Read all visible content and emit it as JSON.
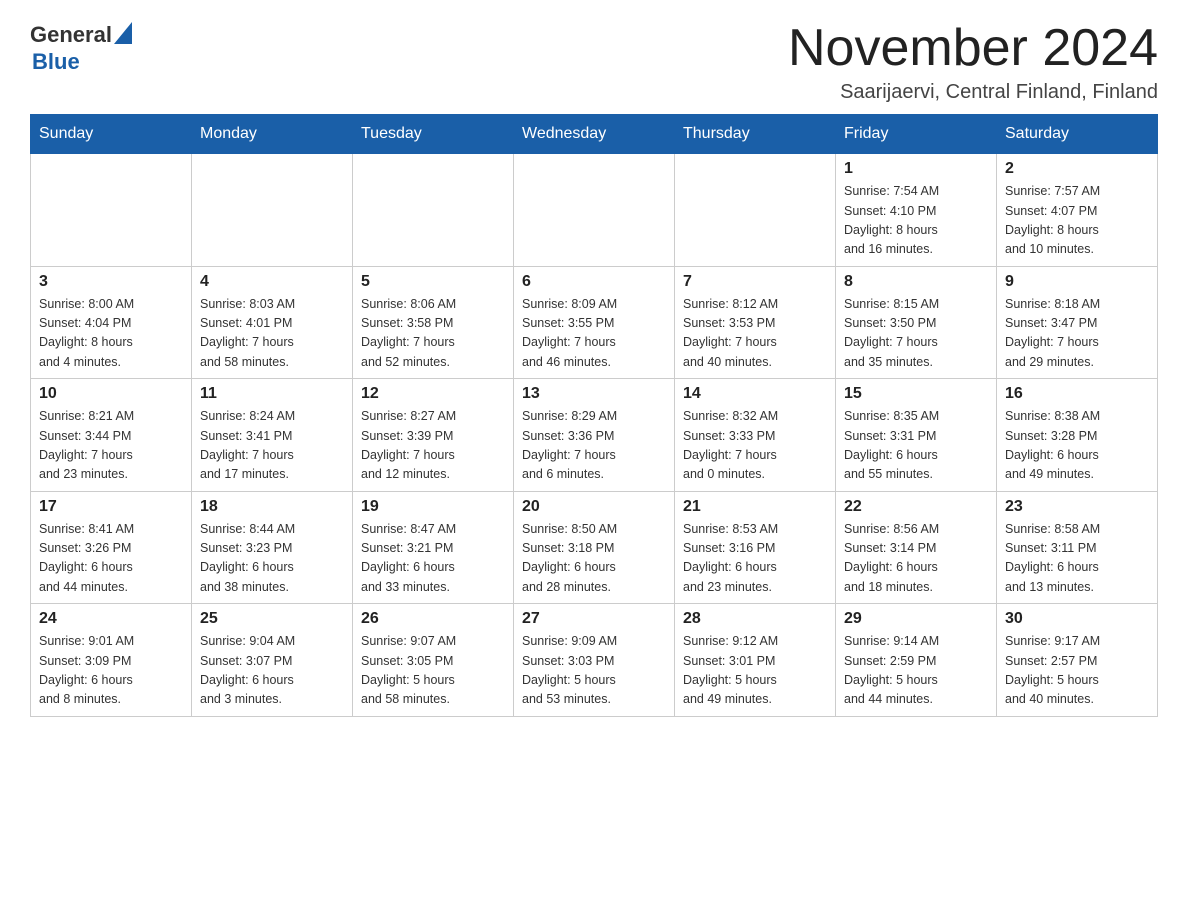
{
  "header": {
    "logo_general": "General",
    "logo_blue": "Blue",
    "month_title": "November 2024",
    "location": "Saarijaervi, Central Finland, Finland"
  },
  "weekdays": [
    "Sunday",
    "Monday",
    "Tuesday",
    "Wednesday",
    "Thursday",
    "Friday",
    "Saturday"
  ],
  "weeks": [
    [
      {
        "day": "",
        "info": ""
      },
      {
        "day": "",
        "info": ""
      },
      {
        "day": "",
        "info": ""
      },
      {
        "day": "",
        "info": ""
      },
      {
        "day": "",
        "info": ""
      },
      {
        "day": "1",
        "info": "Sunrise: 7:54 AM\nSunset: 4:10 PM\nDaylight: 8 hours\nand 16 minutes."
      },
      {
        "day": "2",
        "info": "Sunrise: 7:57 AM\nSunset: 4:07 PM\nDaylight: 8 hours\nand 10 minutes."
      }
    ],
    [
      {
        "day": "3",
        "info": "Sunrise: 8:00 AM\nSunset: 4:04 PM\nDaylight: 8 hours\nand 4 minutes."
      },
      {
        "day": "4",
        "info": "Sunrise: 8:03 AM\nSunset: 4:01 PM\nDaylight: 7 hours\nand 58 minutes."
      },
      {
        "day": "5",
        "info": "Sunrise: 8:06 AM\nSunset: 3:58 PM\nDaylight: 7 hours\nand 52 minutes."
      },
      {
        "day": "6",
        "info": "Sunrise: 8:09 AM\nSunset: 3:55 PM\nDaylight: 7 hours\nand 46 minutes."
      },
      {
        "day": "7",
        "info": "Sunrise: 8:12 AM\nSunset: 3:53 PM\nDaylight: 7 hours\nand 40 minutes."
      },
      {
        "day": "8",
        "info": "Sunrise: 8:15 AM\nSunset: 3:50 PM\nDaylight: 7 hours\nand 35 minutes."
      },
      {
        "day": "9",
        "info": "Sunrise: 8:18 AM\nSunset: 3:47 PM\nDaylight: 7 hours\nand 29 minutes."
      }
    ],
    [
      {
        "day": "10",
        "info": "Sunrise: 8:21 AM\nSunset: 3:44 PM\nDaylight: 7 hours\nand 23 minutes."
      },
      {
        "day": "11",
        "info": "Sunrise: 8:24 AM\nSunset: 3:41 PM\nDaylight: 7 hours\nand 17 minutes."
      },
      {
        "day": "12",
        "info": "Sunrise: 8:27 AM\nSunset: 3:39 PM\nDaylight: 7 hours\nand 12 minutes."
      },
      {
        "day": "13",
        "info": "Sunrise: 8:29 AM\nSunset: 3:36 PM\nDaylight: 7 hours\nand 6 minutes."
      },
      {
        "day": "14",
        "info": "Sunrise: 8:32 AM\nSunset: 3:33 PM\nDaylight: 7 hours\nand 0 minutes."
      },
      {
        "day": "15",
        "info": "Sunrise: 8:35 AM\nSunset: 3:31 PM\nDaylight: 6 hours\nand 55 minutes."
      },
      {
        "day": "16",
        "info": "Sunrise: 8:38 AM\nSunset: 3:28 PM\nDaylight: 6 hours\nand 49 minutes."
      }
    ],
    [
      {
        "day": "17",
        "info": "Sunrise: 8:41 AM\nSunset: 3:26 PM\nDaylight: 6 hours\nand 44 minutes."
      },
      {
        "day": "18",
        "info": "Sunrise: 8:44 AM\nSunset: 3:23 PM\nDaylight: 6 hours\nand 38 minutes."
      },
      {
        "day": "19",
        "info": "Sunrise: 8:47 AM\nSunset: 3:21 PM\nDaylight: 6 hours\nand 33 minutes."
      },
      {
        "day": "20",
        "info": "Sunrise: 8:50 AM\nSunset: 3:18 PM\nDaylight: 6 hours\nand 28 minutes."
      },
      {
        "day": "21",
        "info": "Sunrise: 8:53 AM\nSunset: 3:16 PM\nDaylight: 6 hours\nand 23 minutes."
      },
      {
        "day": "22",
        "info": "Sunrise: 8:56 AM\nSunset: 3:14 PM\nDaylight: 6 hours\nand 18 minutes."
      },
      {
        "day": "23",
        "info": "Sunrise: 8:58 AM\nSunset: 3:11 PM\nDaylight: 6 hours\nand 13 minutes."
      }
    ],
    [
      {
        "day": "24",
        "info": "Sunrise: 9:01 AM\nSunset: 3:09 PM\nDaylight: 6 hours\nand 8 minutes."
      },
      {
        "day": "25",
        "info": "Sunrise: 9:04 AM\nSunset: 3:07 PM\nDaylight: 6 hours\nand 3 minutes."
      },
      {
        "day": "26",
        "info": "Sunrise: 9:07 AM\nSunset: 3:05 PM\nDaylight: 5 hours\nand 58 minutes."
      },
      {
        "day": "27",
        "info": "Sunrise: 9:09 AM\nSunset: 3:03 PM\nDaylight: 5 hours\nand 53 minutes."
      },
      {
        "day": "28",
        "info": "Sunrise: 9:12 AM\nSunset: 3:01 PM\nDaylight: 5 hours\nand 49 minutes."
      },
      {
        "day": "29",
        "info": "Sunrise: 9:14 AM\nSunset: 2:59 PM\nDaylight: 5 hours\nand 44 minutes."
      },
      {
        "day": "30",
        "info": "Sunrise: 9:17 AM\nSunset: 2:57 PM\nDaylight: 5 hours\nand 40 minutes."
      }
    ]
  ]
}
